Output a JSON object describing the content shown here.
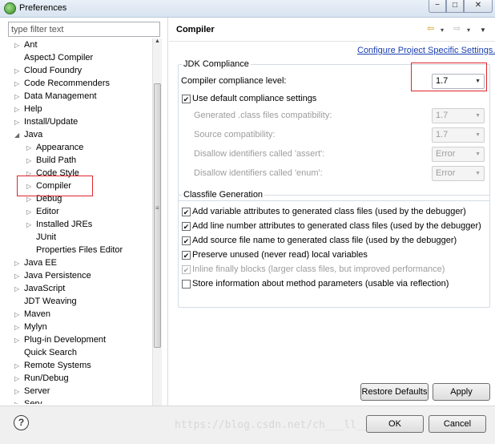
{
  "window": {
    "title": "Preferences",
    "minimize_glyph": "−",
    "maximize_glyph": "□",
    "close_glyph": "✕"
  },
  "filter": {
    "placeholder": "type filter text"
  },
  "tree": [
    {
      "label": "Ant",
      "arrow": "▷",
      "indent": 0
    },
    {
      "label": "AspectJ Compiler",
      "arrow": "",
      "indent": 0
    },
    {
      "label": "Cloud Foundry",
      "arrow": "▷",
      "indent": 0
    },
    {
      "label": "Code Recommenders",
      "arrow": "▷",
      "indent": 0
    },
    {
      "label": "Data Management",
      "arrow": "▷",
      "indent": 0
    },
    {
      "label": "Help",
      "arrow": "▷",
      "indent": 0
    },
    {
      "label": "Install/Update",
      "arrow": "▷",
      "indent": 0
    },
    {
      "label": "Java",
      "arrow": "◢",
      "indent": 0
    },
    {
      "label": "Appearance",
      "arrow": "▷",
      "indent": 1
    },
    {
      "label": "Build Path",
      "arrow": "▷",
      "indent": 1
    },
    {
      "label": "Code Style",
      "arrow": "▷",
      "indent": 1
    },
    {
      "label": "Compiler",
      "arrow": "▷",
      "indent": 1,
      "selected": true
    },
    {
      "label": "Debug",
      "arrow": "▷",
      "indent": 1
    },
    {
      "label": "Editor",
      "arrow": "▷",
      "indent": 1
    },
    {
      "label": "Installed JREs",
      "arrow": "▷",
      "indent": 1
    },
    {
      "label": "JUnit",
      "arrow": "",
      "indent": 1
    },
    {
      "label": "Properties Files Editor",
      "arrow": "",
      "indent": 1
    },
    {
      "label": "Java EE",
      "arrow": "▷",
      "indent": 0
    },
    {
      "label": "Java Persistence",
      "arrow": "▷",
      "indent": 0
    },
    {
      "label": "JavaScript",
      "arrow": "▷",
      "indent": 0
    },
    {
      "label": "JDT Weaving",
      "arrow": "",
      "indent": 0
    },
    {
      "label": "Maven",
      "arrow": "▷",
      "indent": 0
    },
    {
      "label": "Mylyn",
      "arrow": "▷",
      "indent": 0
    },
    {
      "label": "Plug-in Development",
      "arrow": "▷",
      "indent": 0
    },
    {
      "label": "Quick Search",
      "arrow": "",
      "indent": 0
    },
    {
      "label": "Remote Systems",
      "arrow": "▷",
      "indent": 0
    },
    {
      "label": "Run/Debug",
      "arrow": "▷",
      "indent": 0
    },
    {
      "label": "Server",
      "arrow": "▷",
      "indent": 0
    },
    {
      "label": "Serv",
      "arrow": "▷",
      "indent": 0
    }
  ],
  "scrollbar": {
    "up": "▲",
    "down": "▼",
    "grip": "≡"
  },
  "page": {
    "title": "Compiler",
    "nav": {
      "back": "⇦",
      "forward": "⇨",
      "dropdown": "▾",
      "menu": "▼"
    },
    "configure_link": "Configure Project Specific Settings..."
  },
  "jdk": {
    "title": "JDK Compliance",
    "compliance_label": "Compiler compliance level:",
    "compliance_value": "1.7",
    "use_default_label": "Use default compliance settings",
    "use_default_checked": true,
    "check_glyph": "✔",
    "dropdown_glyph": "▼",
    "rows": [
      {
        "label": "Generated .class files compatibility:",
        "value": "1.7"
      },
      {
        "label": "Source compatibility:",
        "value": "1.7"
      },
      {
        "label": "Disallow identifiers called 'assert':",
        "value": "Error"
      },
      {
        "label": "Disallow identifiers called 'enum':",
        "value": "Error"
      }
    ]
  },
  "classfile": {
    "title": "Classfile Generation",
    "options": [
      {
        "label": "Add variable attributes to generated class files (used by the debugger)",
        "checked": true,
        "disabled": false
      },
      {
        "label": "Add line number attributes to generated class files (used by the debugger)",
        "checked": true,
        "disabled": false
      },
      {
        "label": "Add source file name to generated class file (used by the debugger)",
        "checked": true,
        "disabled": false
      },
      {
        "label": "Preserve unused (never read) local variables",
        "checked": true,
        "disabled": false
      },
      {
        "label": "Inline finally blocks (larger class files, but improved performance)",
        "checked": true,
        "disabled": true
      },
      {
        "label": "Store information about method parameters (usable via reflection)",
        "checked": false,
        "disabled": false
      }
    ]
  },
  "buttons": {
    "restore": "Restore Defaults",
    "apply": "Apply",
    "ok": "OK",
    "cancel": "Cancel",
    "help": "?"
  },
  "watermark": "https://blog.csdn.net/ch___ll___l",
  "colors": {
    "highlight": "#e0262b",
    "link": "#1a3fb0"
  }
}
